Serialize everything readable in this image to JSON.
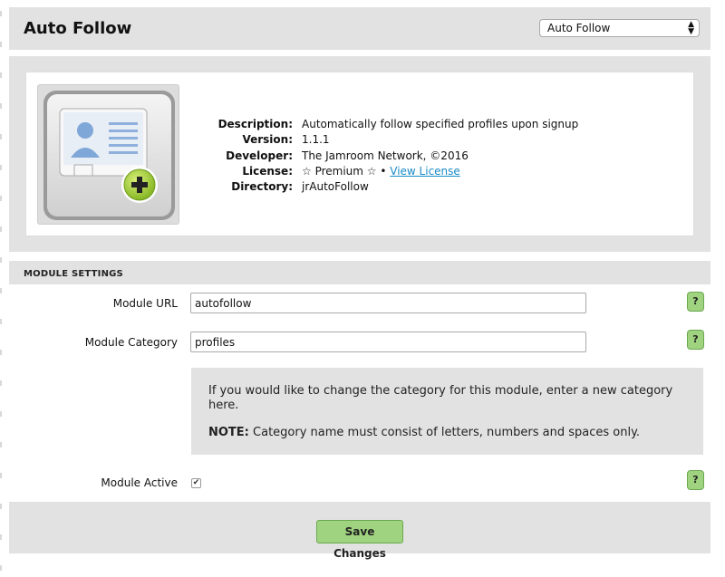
{
  "header": {
    "title": "Auto Follow",
    "module_select_value": "Auto Follow",
    "module_select_arrows": "▲\n▼"
  },
  "info": {
    "rows": [
      {
        "key": "Description:",
        "value": "Automatically follow specified profiles upon signup"
      },
      {
        "key": "Version:",
        "value": "1.1.1"
      },
      {
        "key": "Developer:",
        "value": "The Jamroom Network, ©2016"
      },
      {
        "key": "License:",
        "value": "☆ Premium ☆  •",
        "link": "View License"
      },
      {
        "key": "Directory:",
        "value": "jrAutoFollow"
      }
    ]
  },
  "module_settings": {
    "section_title": "MODULE SETTINGS",
    "url_label": "Module URL",
    "url_value": "autofollow",
    "category_label": "Module Category",
    "category_value": "profiles",
    "help_label": "?",
    "notice_text": "If you would like to change the category for this module, enter a new category here.",
    "notice_note_label": "NOTE:",
    "notice_note_text": " Category name must consist of letters, numbers and spaces only.",
    "active_label": "Module Active",
    "active_checked": true
  },
  "footer": {
    "save_label": "Save Changes"
  },
  "colors": {
    "panel_bg": "#e2e2e2",
    "button_green": "#9fd37f",
    "link_blue": "#1a8ac7"
  }
}
